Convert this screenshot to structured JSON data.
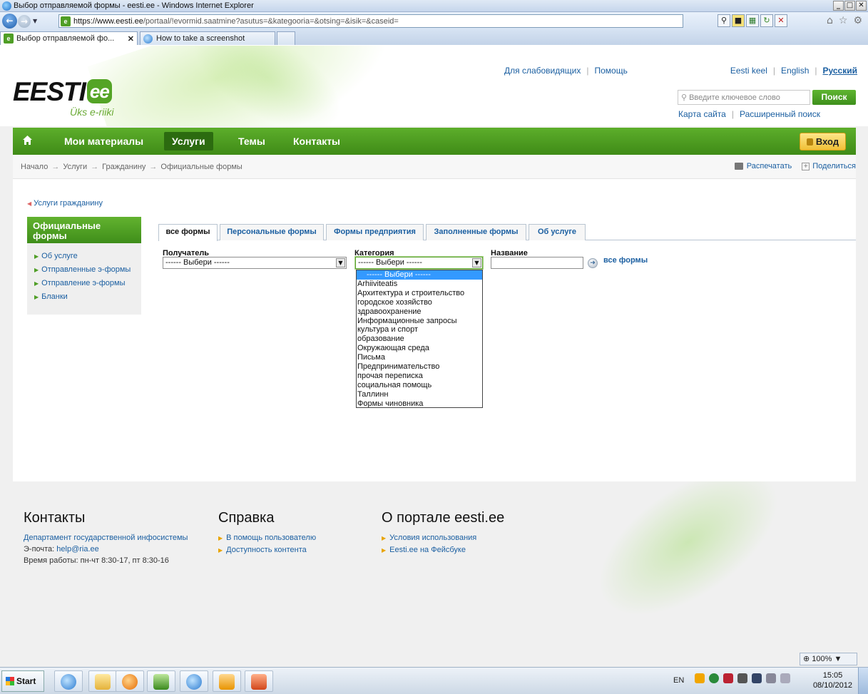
{
  "window": {
    "title": "Выбор отправляемой формы - eesti.ee - Windows Internet Explorer",
    "buttons": [
      "_",
      "□",
      "✕"
    ]
  },
  "address": {
    "url_host": "https://www.eesti.ee",
    "url_path": "/portaal/!evormid.saatmine?asutus=&kategooria=&otsing=&isik=&caseid="
  },
  "tabs": [
    {
      "label": "Выбор отправляемой фо...",
      "close": "✕"
    },
    {
      "label": "How to take a screenshot"
    }
  ],
  "header": {
    "logo_text": "EESTI",
    "logo_badge": "ee",
    "tagline": "Üks e-riiki",
    "toplinks": [
      "Для слабовидящих",
      "Помощь"
    ],
    "languages": [
      "Eesti keel",
      "English",
      "Русский"
    ],
    "search_placeholder": "Введите ключевое слово",
    "search_button": "Поиск",
    "sitelinks": [
      "Карта сайта",
      "Расширенный поиск"
    ]
  },
  "nav": {
    "items": [
      "Мои материалы",
      "Услуги",
      "Темы",
      "Контакты"
    ],
    "login": "Вход"
  },
  "breadcrumb": {
    "items": [
      "Начало",
      "Услуги",
      "Гражданину",
      "Официальные формы"
    ],
    "print": "Распечатать",
    "share": "Поделиться"
  },
  "content": {
    "back_link": "Услуги гражданину",
    "sidebar": {
      "title_line1": "Официальные",
      "title_line2": "формы",
      "items": [
        "Об услуге",
        "Отправленные э-формы",
        "Отправление э-формы",
        "Бланки"
      ]
    },
    "tabs": [
      "все формы",
      "Персональные формы",
      "Формы предприятия",
      "Заполненные формы",
      "Об услуге"
    ],
    "filters": {
      "recipient_label": "Получатель",
      "recipient_value": "------ Выбери ------",
      "category_label": "Категория",
      "category_value": "------ Выбери ------",
      "name_label": "Название",
      "all_forms_link": "все формы"
    },
    "category_options": [
      "------ Выбери ------",
      "Arhiiviteatis",
      "Архитектура и строительство",
      "городское хозяйство",
      "здравоохранение",
      "Информационные запросы",
      "культура и спорт",
      "образование",
      "Окружающая среда",
      "Письма",
      "Предпринимательство",
      "прочая переписка",
      "социальная помощь",
      "Таллинн",
      "Формы чиновника"
    ]
  },
  "footer": {
    "contacts": {
      "title": "Контакты",
      "org": "Департамент государственной инфосистемы",
      "email_label": "Э-почта: ",
      "email": "help@ria.ee",
      "hours": "Время работы: пн-чт 8:30-17, пт 8:30-16"
    },
    "help": {
      "title": "Справка",
      "links": [
        "В помощь пользователю",
        "Доступность контента"
      ]
    },
    "about": {
      "title": "О портале eesti.ee",
      "links": [
        "Условия использования",
        "Eesti.ee на Фейсбуке"
      ]
    }
  },
  "statusbar": {
    "zoom": "100%"
  },
  "taskbar": {
    "start": "Start",
    "lang": "EN",
    "time": "15:05",
    "date": "08/10/2012"
  }
}
